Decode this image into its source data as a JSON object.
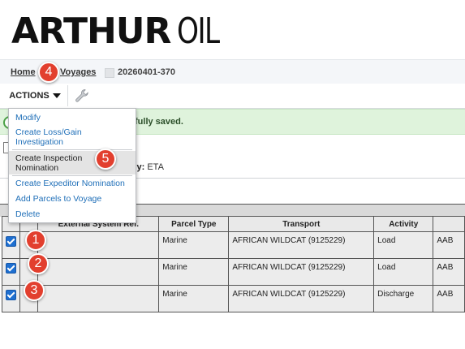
{
  "brand": {
    "name_bold": "ARTHUR",
    "name_light": "OIL"
  },
  "breadcrumb": {
    "home": "Home",
    "voyages": "Voyages",
    "current": "20260401-370"
  },
  "toolbar": {
    "actions_label": "ACTIONS",
    "tools_icon": "wrench-icon"
  },
  "notice": {
    "text": "fully saved."
  },
  "details": {
    "reported_label": "orted By:",
    "reported_value": "ETA"
  },
  "actions_menu": {
    "items": [
      {
        "label": "Modify"
      },
      {
        "label": "Create Loss/Gain Investigation"
      },
      {
        "label": "Create Inspection Nomination"
      },
      {
        "label": "Create Expeditor Nomination"
      },
      {
        "label": "Add Parcels to Voyage"
      },
      {
        "label": "Delete"
      }
    ]
  },
  "grid": {
    "columns": [
      "",
      "",
      "External System Ref.",
      "Parcel Type",
      "Transport",
      "Activity",
      ""
    ],
    "rows": [
      {
        "checked": true,
        "ref": "",
        "parcel_type": "Marine",
        "transport": "AFRICAN WILDCAT (9125229)",
        "activity": "Load",
        "extra": "AAB"
      },
      {
        "checked": true,
        "ref": "",
        "parcel_type": "Marine",
        "transport": "AFRICAN WILDCAT (9125229)",
        "activity": "Load",
        "extra": "AAB"
      },
      {
        "checked": true,
        "ref": "",
        "parcel_type": "Marine",
        "transport": "AFRICAN WILDCAT (9125229)",
        "activity": "Discharge",
        "extra": "AAB"
      }
    ]
  },
  "steps": [
    "1",
    "2",
    "3",
    "4",
    "5"
  ],
  "colors": {
    "step_marker": "#e23f2e",
    "link": "#1f6fb8",
    "success_bg": "#dff3dc",
    "checkbox": "#1e6fd0"
  }
}
